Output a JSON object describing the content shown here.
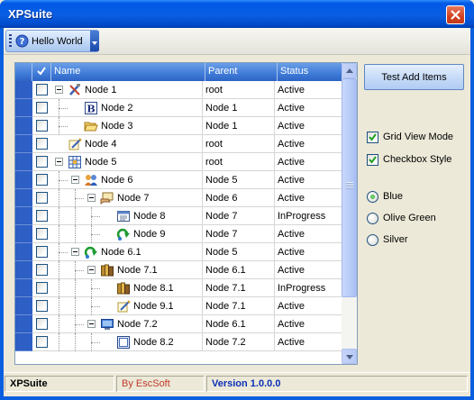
{
  "window": {
    "title": "XPSuite"
  },
  "toolbar": {
    "hello_label": "Hello World"
  },
  "grid": {
    "columns": [
      "Name",
      "Parent",
      "Status"
    ],
    "rows": [
      {
        "name": "Node 1",
        "parent": "root",
        "status": "Active",
        "level": 0,
        "expander": true,
        "icon": "tools-icon"
      },
      {
        "name": "Node 2",
        "parent": "Node 1",
        "status": "Active",
        "level": 1,
        "expander": false,
        "icon": "bold-b-icon"
      },
      {
        "name": "Node 3",
        "parent": "Node 1",
        "status": "Active",
        "level": 1,
        "expander": false,
        "icon": "open-folder-icon"
      },
      {
        "name": "Node 4",
        "parent": "root",
        "status": "Active",
        "level": 0,
        "expander": false,
        "icon": "edit-note-icon"
      },
      {
        "name": "Node 5",
        "parent": "root",
        "status": "Active",
        "level": 0,
        "expander": true,
        "icon": "grid-table-icon"
      },
      {
        "name": "Node 6",
        "parent": "Node 5",
        "status": "Active",
        "level": 1,
        "expander": true,
        "icon": "users-icon"
      },
      {
        "name": "Node 7",
        "parent": "Node 6",
        "status": "Active",
        "level": 2,
        "expander": true,
        "icon": "hand-card-icon"
      },
      {
        "name": "Node 8",
        "parent": "Node 7",
        "status": "InProgress",
        "level": 3,
        "expander": false,
        "icon": "list-window-icon"
      },
      {
        "name": "Node 9",
        "parent": "Node 7",
        "status": "Active",
        "level": 3,
        "expander": false,
        "icon": "green-refresh-icon"
      },
      {
        "name": "Node 6.1",
        "parent": "Node 5",
        "status": "Active",
        "level": 1,
        "expander": true,
        "icon": "green-refresh-icon"
      },
      {
        "name": "Node 7.1",
        "parent": "Node 6.1",
        "status": "Active",
        "level": 2,
        "expander": true,
        "icon": "books-icon"
      },
      {
        "name": "Node 8.1",
        "parent": "Node 7.1",
        "status": "InProgress",
        "level": 3,
        "expander": false,
        "icon": "books-icon"
      },
      {
        "name": "Node 9.1",
        "parent": "Node 7.1",
        "status": "Active",
        "level": 3,
        "expander": false,
        "icon": "edit-note-icon"
      },
      {
        "name": "Node 7.2",
        "parent": "Node 6.1",
        "status": "Active",
        "level": 2,
        "expander": true,
        "icon": "monitor-icon"
      },
      {
        "name": "Node 8.2",
        "parent": "Node 7.2",
        "status": "Active",
        "level": 3,
        "expander": false,
        "icon": "window-icon"
      }
    ]
  },
  "panel": {
    "test_button": "Test Add Items",
    "grid_view_mode": {
      "label": "Grid View Mode",
      "checked": true
    },
    "checkbox_style": {
      "label": "Checkbox Style",
      "checked": true
    },
    "themes": [
      {
        "label": "Blue",
        "selected": true
      },
      {
        "label": "Olive Green",
        "selected": false
      },
      {
        "label": "Silver",
        "selected": false
      }
    ]
  },
  "statusbar": {
    "app": "XPSuite",
    "author": "By EscSoft",
    "version": "Version 1.0.0.0"
  },
  "colors": {
    "title_blue": "#0058e5",
    "header_blue": "#3f7bd8",
    "author_red": "#c0392b",
    "version_blue": "#0b2fb8"
  }
}
